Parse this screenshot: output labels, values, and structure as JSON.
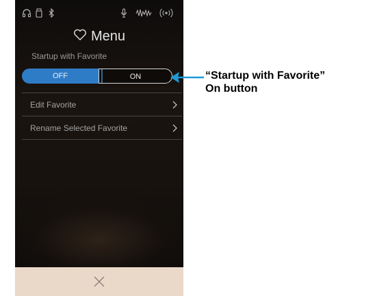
{
  "menu": {
    "title": "Menu",
    "section_label": "Startup with Favorite",
    "toggle": {
      "off_label": "OFF",
      "on_label": "ON",
      "selected": "OFF"
    },
    "rows": [
      {
        "label": "Edit Favorite"
      },
      {
        "label": "Rename Selected Favorite"
      }
    ]
  },
  "status_bar": {
    "icons": [
      "headphones-icon",
      "usb-storage-icon",
      "bluetooth-icon",
      "microphone-icon",
      "audio-wave-icon",
      "wireless-icon"
    ]
  },
  "footer": {
    "icon": "close-icon"
  },
  "callout": {
    "line1": "“Startup with Favorite”",
    "line2": "On button"
  },
  "colors": {
    "toggle_active": "#2f7cc6",
    "footer_bg": "#ead8c9",
    "callout_arrow": "#1e9bd7"
  }
}
